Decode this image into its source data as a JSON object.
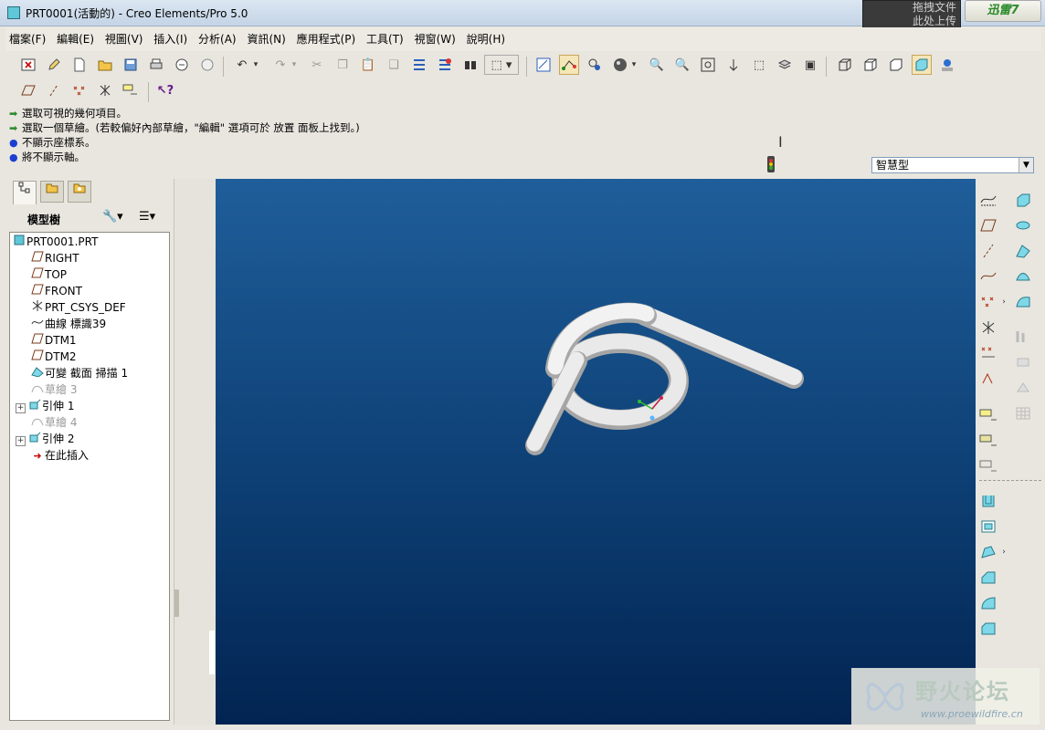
{
  "window": {
    "title": "PRT0001(活動的) - Creo Elements/Pro 5.0",
    "drag_hint": [
      "拖拽文件",
      "此处上传"
    ],
    "xunlei_label": "迅雷7"
  },
  "menu": [
    "檔案(F)",
    "編輯(E)",
    "視圖(V)",
    "插入(I)",
    "分析(A)",
    "資訊(N)",
    "應用程式(P)",
    "工具(T)",
    "視窗(W)",
    "說明(H)"
  ],
  "messages": [
    {
      "kind": "arrow",
      "text": "選取可視的幾何項目。"
    },
    {
      "kind": "arrow",
      "text": "選取一個草繪。(若較偏好內部草繪，\"編輯\" 選項可於 放置 面板上找到。)"
    },
    {
      "kind": "dot",
      "text": "不顯示座標系。"
    },
    {
      "kind": "dot",
      "text": "將不顯示軸。"
    }
  ],
  "filter": {
    "value": "智慧型"
  },
  "model_tree": {
    "header": "模型樹",
    "nodes": [
      {
        "label": "PRT0001.PRT",
        "icon": "part-icon"
      },
      {
        "label": "RIGHT",
        "icon": "datum-plane-icon"
      },
      {
        "label": "TOP",
        "icon": "datum-plane-icon"
      },
      {
        "label": "FRONT",
        "icon": "datum-plane-icon"
      },
      {
        "label": "PRT_CSYS_DEF",
        "icon": "csys-icon"
      },
      {
        "label": "曲線 標識39",
        "icon": "curve-icon"
      },
      {
        "label": "DTM1",
        "icon": "datum-plane-icon"
      },
      {
        "label": "DTM2",
        "icon": "datum-plane-icon"
      },
      {
        "label": "可變 截面 掃描 1",
        "icon": "sweep-icon"
      },
      {
        "label": "草繪 3",
        "icon": "sketch-icon"
      },
      {
        "label": "引伸 1",
        "icon": "extrude-icon"
      },
      {
        "label": "草繪 4",
        "icon": "sketch-icon"
      },
      {
        "label": "引伸 2",
        "icon": "extrude-icon"
      },
      {
        "label": "在此插入",
        "icon": "insert-here-icon"
      }
    ]
  },
  "watermark": {
    "name": "野火论坛",
    "url": "www.proewildfire.cn"
  },
  "colors": {
    "viewport_top": "#1f5e9a",
    "viewport_bottom": "#022452",
    "model": "#e6e6e6"
  }
}
